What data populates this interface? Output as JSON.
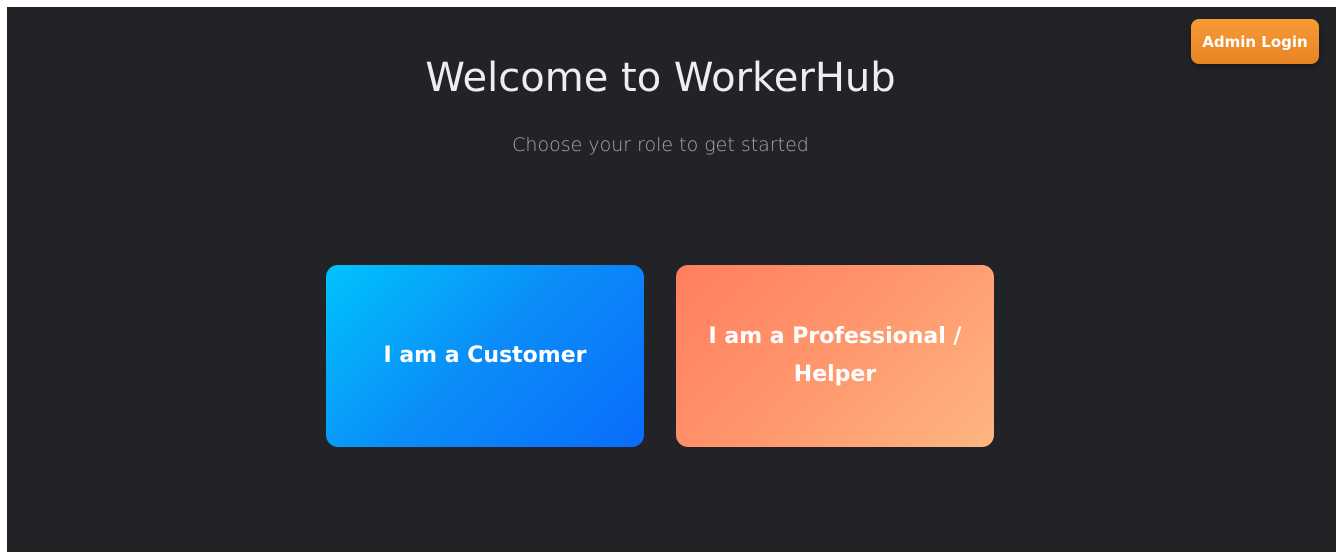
{
  "header": {
    "admin_login_label": "Admin Login"
  },
  "hero": {
    "title": "Welcome to WorkerHub",
    "subtitle": "Choose your role to get started"
  },
  "roles": [
    {
      "label": "I am a Customer"
    },
    {
      "label": "I am a Professional / Helper"
    }
  ],
  "colors": {
    "background": "#222327",
    "admin_button": "#f08f2e",
    "customer_gradient_start": "#00c3fc",
    "customer_gradient_end": "#0a6cfb",
    "professional_gradient_start": "#ff7f5e",
    "professional_gradient_end": "#fdb681"
  }
}
